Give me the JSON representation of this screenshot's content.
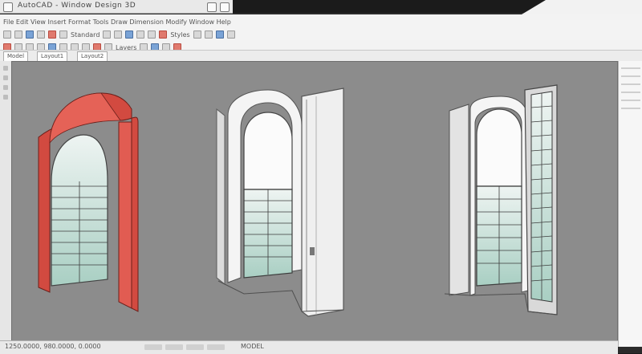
{
  "window": {
    "title": "AutoCAD - Window Design 3D"
  },
  "ribbon": {
    "menu_text": "File  Edit  View  Insert  Format  Tools  Draw  Dimension  Modify  Window  Help",
    "toolbar_text_left": "Standard",
    "toolbar_text_mid": "Styles",
    "toolbar_text_right": "Layers"
  },
  "tabs": [
    {
      "label": "Model"
    },
    {
      "label": "Layout1"
    },
    {
      "label": "Layout2"
    }
  ],
  "viewport": {
    "background": "#8c8c8c",
    "models": [
      {
        "name": "Red arched window frame",
        "color": "#e0584e"
      },
      {
        "name": "White arched door frame",
        "color": "#f1f1f1"
      },
      {
        "name": "Open window with glass panel",
        "color": "#d8d8d8"
      }
    ]
  },
  "status": {
    "coords": "1250.0000, 980.0000, 0.0000",
    "mode": "MODEL"
  },
  "colors": {
    "red": "#e0584e",
    "glass": "#cfe7df",
    "frame": "#4b4b4b"
  }
}
